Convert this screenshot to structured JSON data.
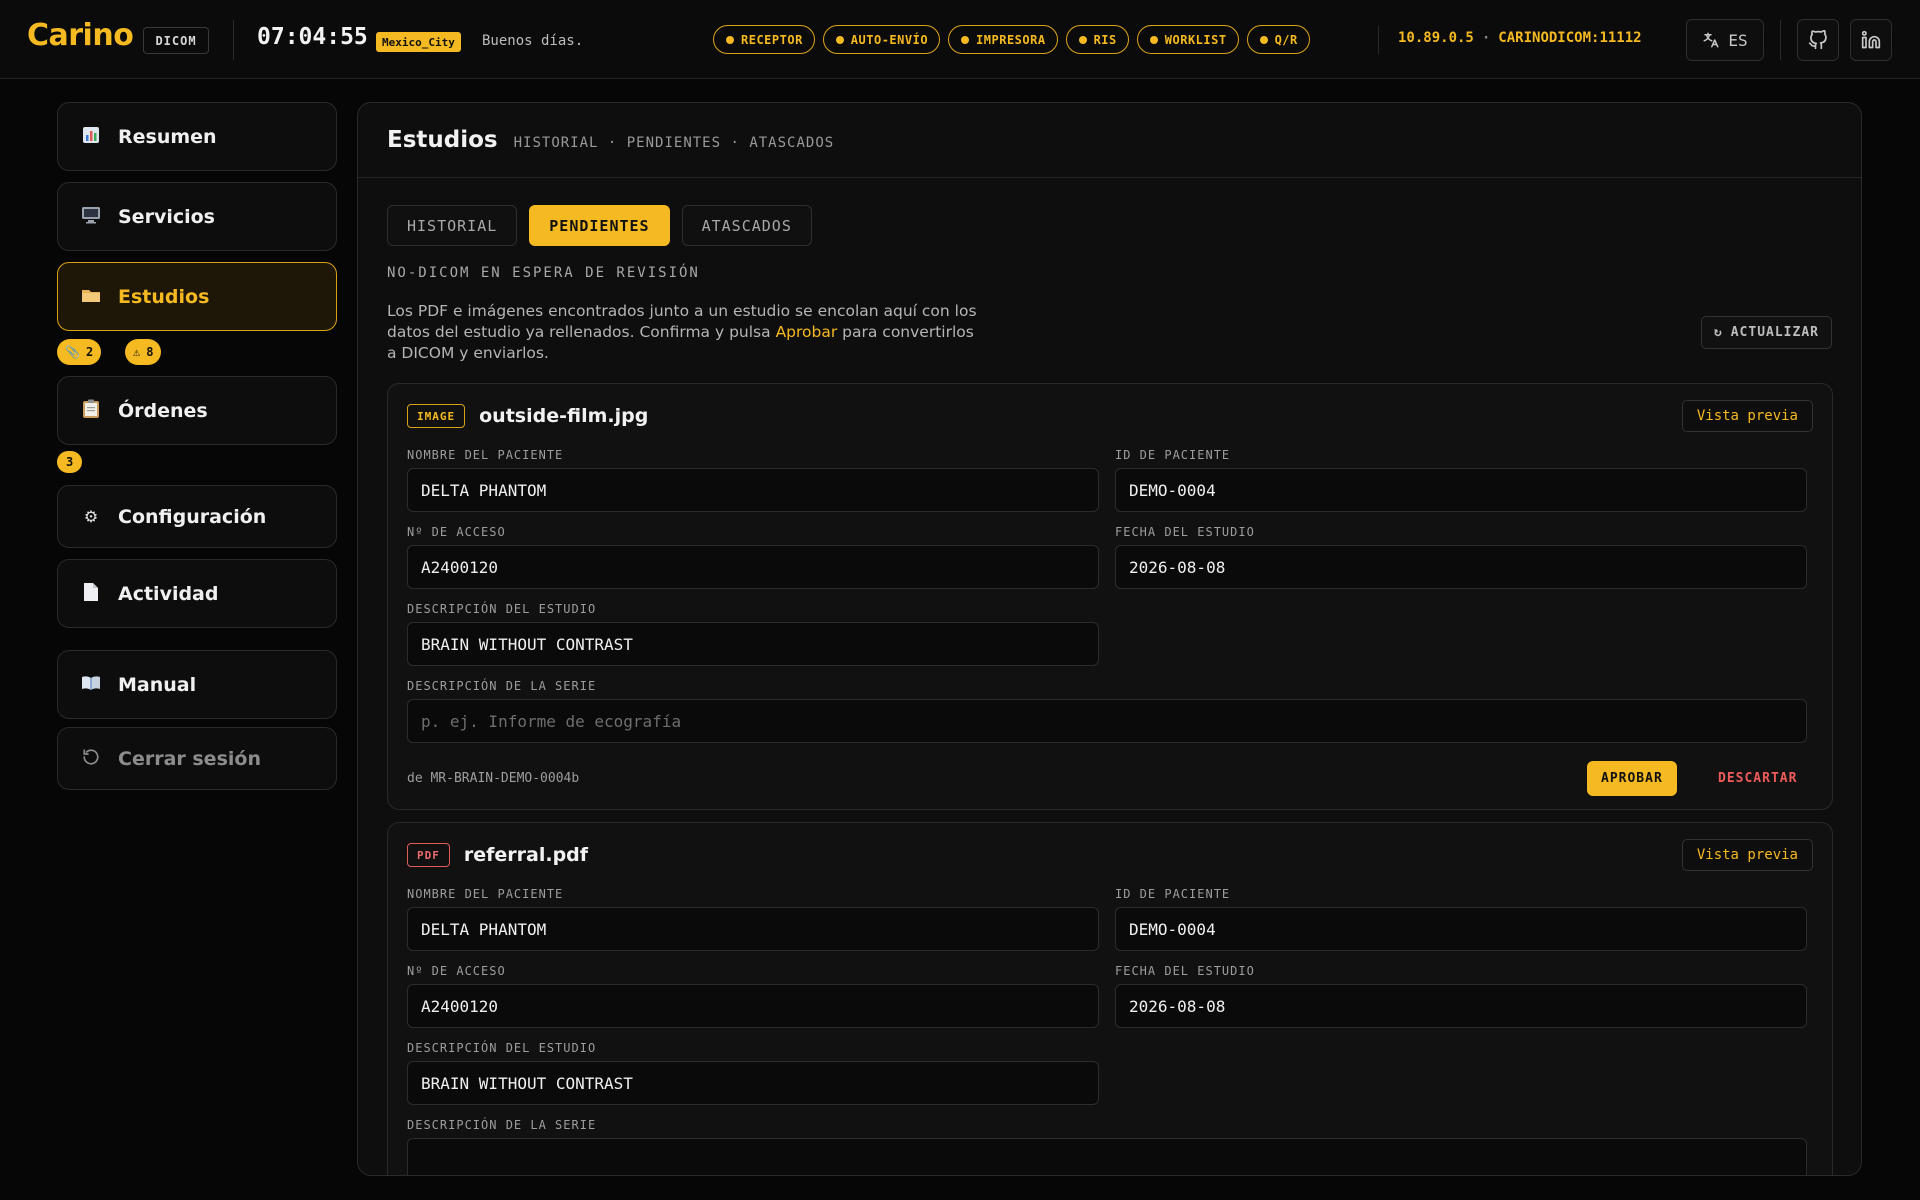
{
  "header": {
    "logo": "Carino",
    "logo_tag": "DICOM",
    "clock": "07:04:55",
    "timezone": "Mexico_City",
    "greeting": "Buenos días.",
    "status_pills": [
      "RECEPTOR",
      "AUTO-ENVÍO",
      "IMPRESORA",
      "RIS",
      "WORKLIST",
      "Q/R"
    ],
    "host_ip": "10.89.0.5",
    "host_sep": "·",
    "host_ae": "CARINODICOM:11112",
    "language": "ES",
    "accent_color": "#f5b922"
  },
  "sidebar": {
    "items": [
      {
        "label": "Resumen",
        "icon": "chart-icon"
      },
      {
        "label": "Servicios",
        "icon": "monitor-icon"
      },
      {
        "label": "Estudios",
        "icon": "folder-icon",
        "active": true
      },
      {
        "label": "Órdenes",
        "icon": "clipboard-icon"
      },
      {
        "label": "Configuración",
        "icon": "gear-icon"
      },
      {
        "label": "Actividad",
        "icon": "document-icon"
      },
      {
        "label": "Manual",
        "icon": "book-icon"
      },
      {
        "label": "Cerrar sesión",
        "icon": "logout-icon"
      }
    ],
    "studies_pending_count": "2",
    "studies_stuck_count": "8",
    "orders_count": "3"
  },
  "main": {
    "title": "Estudios",
    "subtitle": "HISTORIAL · PENDIENTES · ATASCADOS",
    "tabs": [
      "HISTORIAL",
      "PENDIENTES",
      "ATASCADOS"
    ],
    "active_tab": "PENDIENTES",
    "section_label": "NO-DICOM EN ESPERA DE REVISIÓN",
    "intro_before": "Los PDF e imágenes encontrados junto a un estudio se encolan aquí con los datos del estudio ya rellenados. Confirma y pulsa ",
    "intro_highlight": "Aprobar",
    "intro_after": " para convertirlos a DICOM y enviarlos.",
    "refresh_label": "ACTUALIZAR",
    "labels": {
      "patient_name": "NOMBRE DEL PACIENTE",
      "patient_id": "ID DE PACIENTE",
      "accession": "Nº DE ACCESO",
      "study_date": "FECHA DEL ESTUDIO",
      "study_desc": "DESCRIPCIÓN DEL ESTUDIO",
      "series_desc": "DESCRIPCIÓN DE LA SERIE"
    },
    "preview_label": "Vista previa",
    "approve_label": "APROBAR",
    "discard_label": "DESCARTAR",
    "items": [
      {
        "type": "IMAGE",
        "file": "outside-film.jpg",
        "patient_name": "DELTA PHANTOM",
        "patient_id": "DEMO-0004",
        "accession": "A2400120",
        "study_date": "2026-08-08",
        "study_desc": "BRAIN WITHOUT CONTRAST",
        "series_desc": "",
        "series_placeholder": "p. ej. Informe de ecografía",
        "source": "de MR-BRAIN-DEMO-0004b"
      },
      {
        "type": "PDF",
        "file": "referral.pdf",
        "patient_name": "DELTA PHANTOM",
        "patient_id": "DEMO-0004",
        "accession": "A2400120",
        "study_date": "2026-08-08",
        "study_desc": "BRAIN WITHOUT CONTRAST"
      }
    ]
  }
}
